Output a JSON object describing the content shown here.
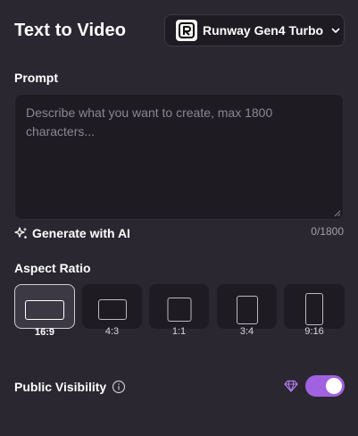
{
  "header": {
    "title": "Text to Video",
    "model": {
      "label": "Runway Gen4 Turbo",
      "logo_icon": "runway-logo-icon",
      "chevron_icon": "chevron-down-icon"
    }
  },
  "prompt": {
    "label": "Prompt",
    "value": "",
    "placeholder": "Describe what you want to create, max 1800 characters...",
    "generate_label": "Generate with AI",
    "generate_icon": "sparkles-icon",
    "char_count": "0/1800"
  },
  "aspect_ratio": {
    "label": "Aspect Ratio",
    "selected": "16:9",
    "options": [
      {
        "label": "16:9"
      },
      {
        "label": "4:3"
      },
      {
        "label": "1:1"
      },
      {
        "label": "3:4"
      },
      {
        "label": "9:16"
      }
    ]
  },
  "visibility": {
    "label": "Public Visibility",
    "info_icon": "info-icon",
    "premium_icon": "diamond-icon",
    "enabled": true
  },
  "colors": {
    "background": "#2a2730",
    "panel": "#1e1b23",
    "accent": "#a062e0",
    "gem": "#b57cf0"
  }
}
